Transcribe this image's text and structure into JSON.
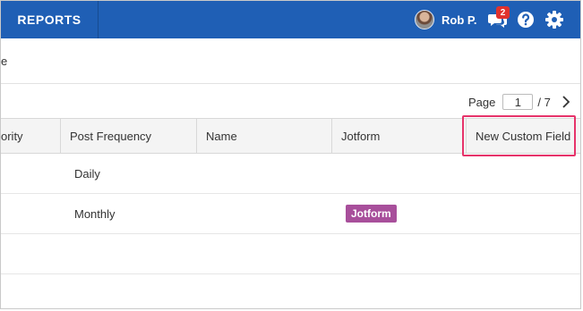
{
  "header": {
    "reports_label": "REPORTS",
    "user_name": "Rob P.",
    "notification_count": "2",
    "colors": {
      "bar": "#1f5fb5",
      "badge": "#e0322d"
    }
  },
  "sub": {
    "text": "e"
  },
  "pager": {
    "label": "Page",
    "current": "1",
    "total": "/ 7"
  },
  "table": {
    "columns": [
      "ority",
      "Post Frequency",
      "Name",
      "Jotform",
      "New Custom Field"
    ],
    "rows": [
      {
        "frequency": "Daily",
        "jotform": ""
      },
      {
        "frequency": "Monthly",
        "jotform": "Jotform"
      },
      {
        "frequency": "",
        "jotform": ""
      }
    ],
    "tag_color": "#a84f9b",
    "highlight_color": "#e6336a"
  },
  "icons": [
    "avatar",
    "chat-icon",
    "help-icon",
    "gear-icon",
    "chevron-right-icon"
  ]
}
